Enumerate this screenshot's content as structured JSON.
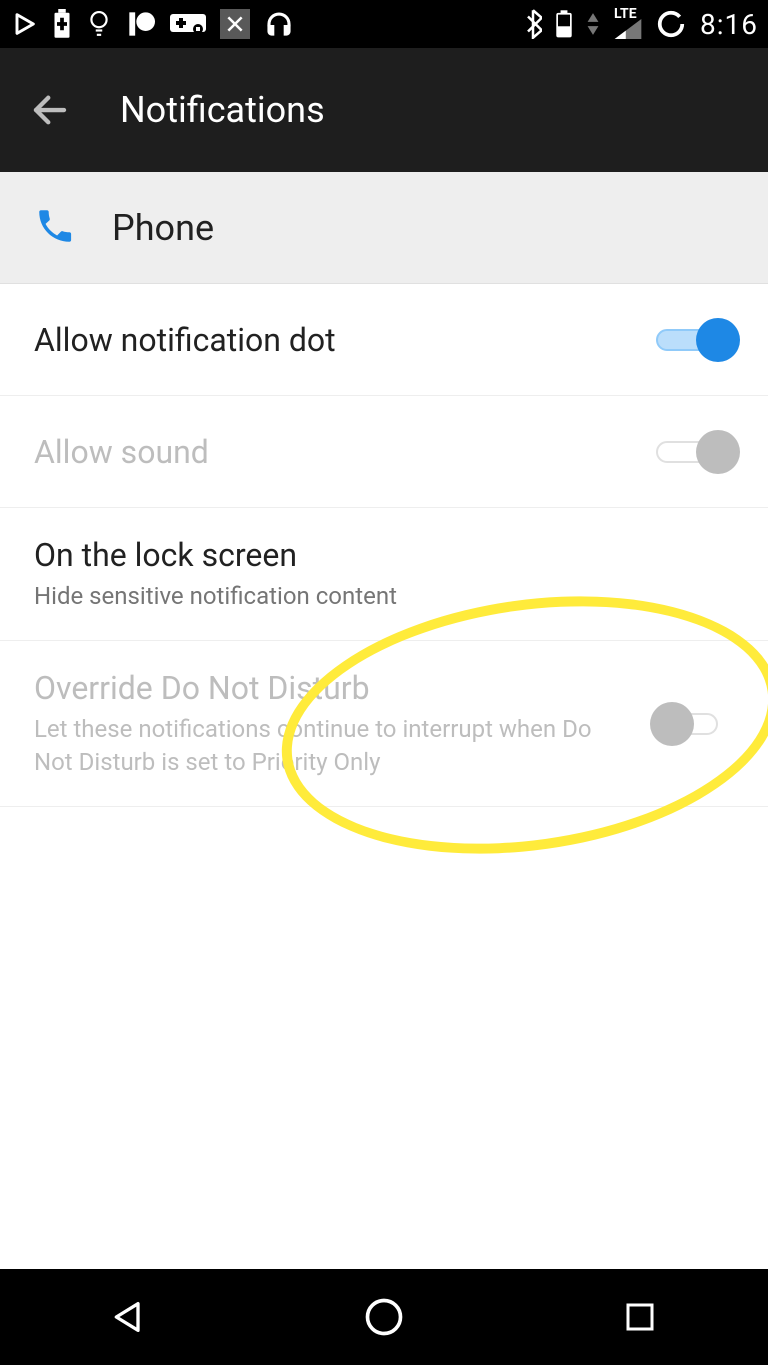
{
  "statusbar": {
    "network_label": "LTE",
    "time": "8:16"
  },
  "appbar": {
    "title": "Notifications"
  },
  "subheader": {
    "app_name": "Phone"
  },
  "settings": {
    "allow_dot": {
      "title": "Allow notification dot"
    },
    "allow_sound": {
      "title": "Allow sound"
    },
    "lock_screen": {
      "title": "On the lock screen",
      "subtitle": "Hide sensitive notification content"
    },
    "override_dnd": {
      "title": "Override Do Not Disturb",
      "subtitle": "Let these notifications continue to interrupt when Do Not Disturb is set to Priority Only"
    }
  }
}
